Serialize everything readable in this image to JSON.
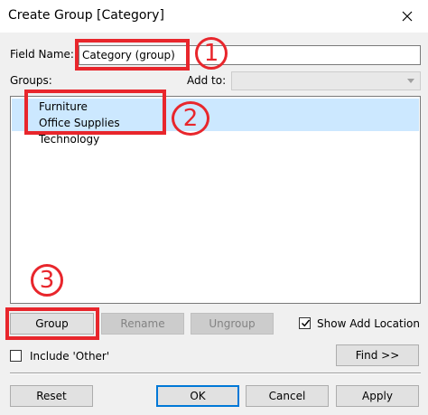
{
  "window": {
    "title": "Create Group [Category]",
    "close_icon": "close-icon"
  },
  "field_name": {
    "label": "Field Name:",
    "value": "Category (group)"
  },
  "groups": {
    "label": "Groups:",
    "items": [
      {
        "label": "Furniture",
        "selected": true
      },
      {
        "label": "Office Supplies",
        "selected": true
      },
      {
        "label": "Technology",
        "selected": false
      }
    ]
  },
  "add_to": {
    "label": "Add to:",
    "value": "",
    "enabled": false
  },
  "actions": {
    "group_label": "Group",
    "rename_label": "Rename",
    "ungroup_label": "Ungroup"
  },
  "show_add_location": {
    "label": "Show Add Location",
    "checked": true
  },
  "include_other": {
    "label": "Include 'Other'",
    "checked": false
  },
  "find_label": "Find >>",
  "footer": {
    "reset_label": "Reset",
    "ok_label": "OK",
    "cancel_label": "Cancel",
    "apply_label": "Apply"
  },
  "annotations": [
    "1",
    "2",
    "3"
  ],
  "colors": {
    "annotation_red": "#e8262c",
    "selection_blue": "#cce8ff",
    "default_button_border": "#0078d7"
  }
}
